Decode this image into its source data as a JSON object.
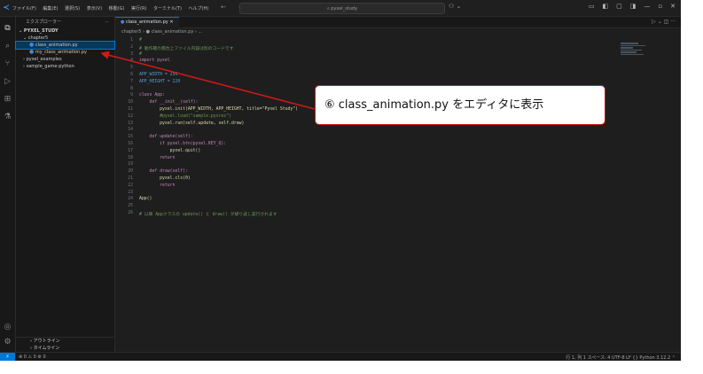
{
  "titlebar": {
    "menus": [
      "ファイル(F)",
      "編集(E)",
      "選択(S)",
      "表示(V)",
      "移動(G)",
      "実行(R)",
      "ターミナル(T)",
      "ヘルプ(H)"
    ],
    "nav": "← →",
    "search": "⌕ pyxel_study",
    "copilot": "⚇ ⌄",
    "window_controls": [
      "▭",
      "◧",
      "▢",
      "◨",
      "—",
      "▫",
      "✕"
    ]
  },
  "activity_icons": [
    {
      "name": "explorer-icon",
      "glyph": "⧉"
    },
    {
      "name": "search-icon",
      "glyph": "⌕"
    },
    {
      "name": "source-control-icon",
      "glyph": "⑂"
    },
    {
      "name": "run-debug-icon",
      "glyph": "▷"
    },
    {
      "name": "extensions-icon",
      "glyph": "⊞"
    },
    {
      "name": "testing-icon",
      "glyph": "⚗"
    }
  ],
  "activity_bottom": {
    "account": "◎",
    "settings": "⚙"
  },
  "sidebar": {
    "title": "エクスプローラー",
    "more": "···",
    "root": "⌄ PYXEL_STUDY",
    "folder": "⌄ chapter5",
    "files": [
      "class_animation.py",
      "my_class_animation.py"
    ],
    "folders": [
      "› pyxel_examples",
      "› sample_game-python"
    ],
    "outline": "› アウトライン",
    "timeline": "› タイムライン"
  },
  "editor": {
    "tab_label": "class_animation.py",
    "tab_close": "✕",
    "tab_actions": "▷ ⌄  ◫  ···",
    "breadcrumb": "chapter5 › ● class_animation.py › ..."
  },
  "code_lines": [
    "#",
    "# 動作確の都合上ファイル内容は別のコードです",
    "#",
    "import pyxel",
    "",
    "APP_WIDTH = 256",
    "APP_HEIGHT = 220",
    "",
    "class App:",
    "    def __init__(self):",
    "        pyxel.init(APP_WIDTH, APP_HEIGHT, title=\"Pyxel Study\")",
    "        #pyxel.load(\"sample.pyxres\")",
    "        pyxel.run(self.update, self.draw)",
    "",
    "    def update(self):",
    "        if pyxel.btn(pyxel.KEY_Q):",
    "            pyxel.quit()",
    "        return",
    "",
    "    def draw(self):",
    "        pyxel.cls(0)",
    "        return",
    "",
    "App()",
    "",
    "# 以降 Appクラスの update() と draw() が繰り返し実行されます"
  ],
  "code_line_numbers": [
    "1",
    "2",
    "3",
    "4",
    "5",
    "6",
    "7",
    "8",
    "9",
    "10",
    "11",
    "12",
    "13",
    "14",
    "15",
    "16",
    "17",
    "18",
    "19",
    "20",
    "21",
    "22",
    "23",
    "24",
    "25",
    "26"
  ],
  "status": {
    "remote": "⚡",
    "left": "⊗ 0 ⚠ 0  ⚙ 0",
    "right": "行 1, 列 1   スペース: 4   UTF-8   LF   {} Python   3.12.2   ⌃"
  },
  "callout": {
    "text": "⑥ class_animation.py をエディタに表示"
  },
  "colors": {
    "accent": "#0078d4",
    "callout_border": "#d01818",
    "keyword": "#c586c0",
    "comment": "#6a9955",
    "string": "#ce9178",
    "builtin": "#569cd6"
  }
}
